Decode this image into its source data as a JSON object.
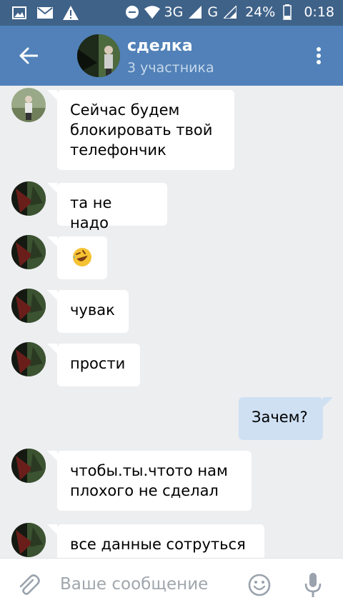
{
  "status_bar": {
    "network_3g": "3G",
    "network_g": "G",
    "battery": "24%",
    "time": "0:18"
  },
  "header": {
    "title": "сделка",
    "subtitle": "3 участника"
  },
  "messages": [
    {
      "direction": "in",
      "text": "Сейчас будем блокировать твой телефончик",
      "avatar": "user-1"
    },
    {
      "direction": "in",
      "text": "та не надо",
      "avatar": "user-2"
    },
    {
      "direction": "in",
      "text": "🤣",
      "avatar": "user-2"
    },
    {
      "direction": "in",
      "text": "чувак",
      "avatar": "user-2"
    },
    {
      "direction": "in",
      "text": "прости",
      "avatar": "user-2"
    },
    {
      "direction": "out",
      "text": "Зачем?"
    },
    {
      "direction": "in",
      "text": "чтобы.ты.чтото нам плохого не сделал",
      "avatar": "user-2"
    },
    {
      "direction": "in",
      "text": "все данные сотруться",
      "avatar": "user-2"
    }
  ],
  "composer": {
    "placeholder": "Ваше сообщение"
  },
  "colors": {
    "status_bar": "#3f6288",
    "toolbar": "#5181b8",
    "background": "#edeef0",
    "incoming_bubble": "#ffffff",
    "outgoing_bubble": "#cfe0f3"
  },
  "icons": [
    "back-arrow-icon",
    "more-vert-icon",
    "paperclip-icon",
    "smiley-icon",
    "microphone-icon"
  ]
}
